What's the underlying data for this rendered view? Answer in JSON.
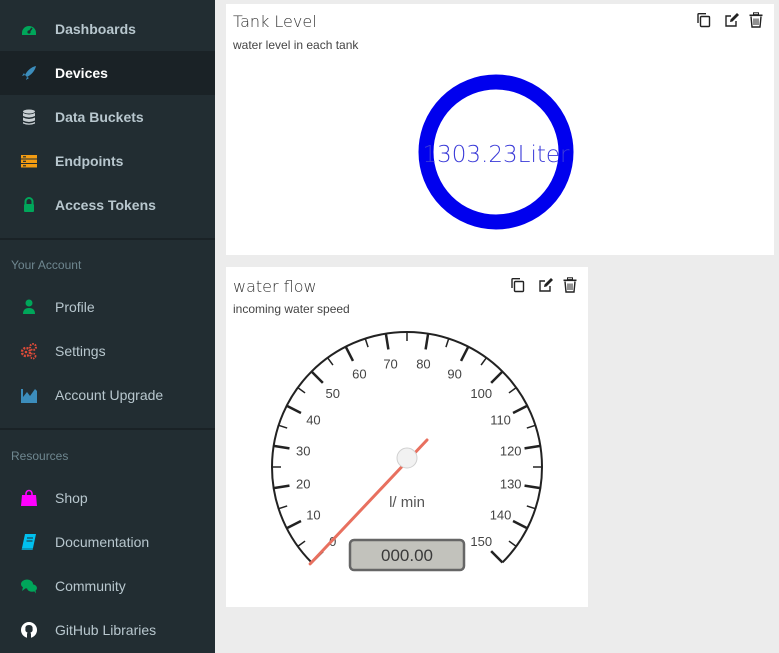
{
  "sidebar": {
    "main_items": [
      {
        "label": "Dashboards",
        "icon": "dashboard-icon",
        "color": "#00a65a"
      },
      {
        "label": "Devices",
        "icon": "rocket-icon",
        "color": "#3c8dbc"
      },
      {
        "label": "Data Buckets",
        "icon": "database-icon",
        "color": "#d2d6de"
      },
      {
        "label": "Endpoints",
        "icon": "endpoints-icon",
        "color": "#f39c12"
      },
      {
        "label": "Access Tokens",
        "icon": "lock-icon",
        "color": "#00a65a"
      }
    ],
    "account_header": "Your Account",
    "account_items": [
      {
        "label": "Profile",
        "icon": "user-icon",
        "color": "#00a65a"
      },
      {
        "label": "Settings",
        "icon": "cogs-icon",
        "color": "#dd4b39"
      },
      {
        "label": "Account Upgrade",
        "icon": "chart-icon",
        "color": "#3c8dbc"
      }
    ],
    "resources_header": "Resources",
    "resources_items": [
      {
        "label": "Shop",
        "icon": "shopping-bag-icon",
        "color": "#ff00ff"
      },
      {
        "label": "Documentation",
        "icon": "book-icon",
        "color": "#00c0ef"
      },
      {
        "label": "Community",
        "icon": "comments-icon",
        "color": "#00a65a"
      },
      {
        "label": "GitHub Libraries",
        "icon": "github-icon",
        "color": "#ffffff"
      }
    ]
  },
  "widgets": {
    "tank": {
      "title": "Tank Level",
      "subtitle": "water level in each tank",
      "value_text": "1303.23Liter",
      "ring_color": "#0000ee"
    },
    "flow": {
      "title": "water flow",
      "subtitle": "incoming water speed",
      "unit": "l/ min",
      "display": "000.00",
      "value": 0,
      "min": 0,
      "max": 150,
      "ticks": [
        "0",
        "10",
        "20",
        "30",
        "40",
        "50",
        "60",
        "70",
        "80",
        "90",
        "100",
        "110",
        "120",
        "130",
        "140",
        "150"
      ],
      "needle_color": "#e8705f"
    }
  }
}
